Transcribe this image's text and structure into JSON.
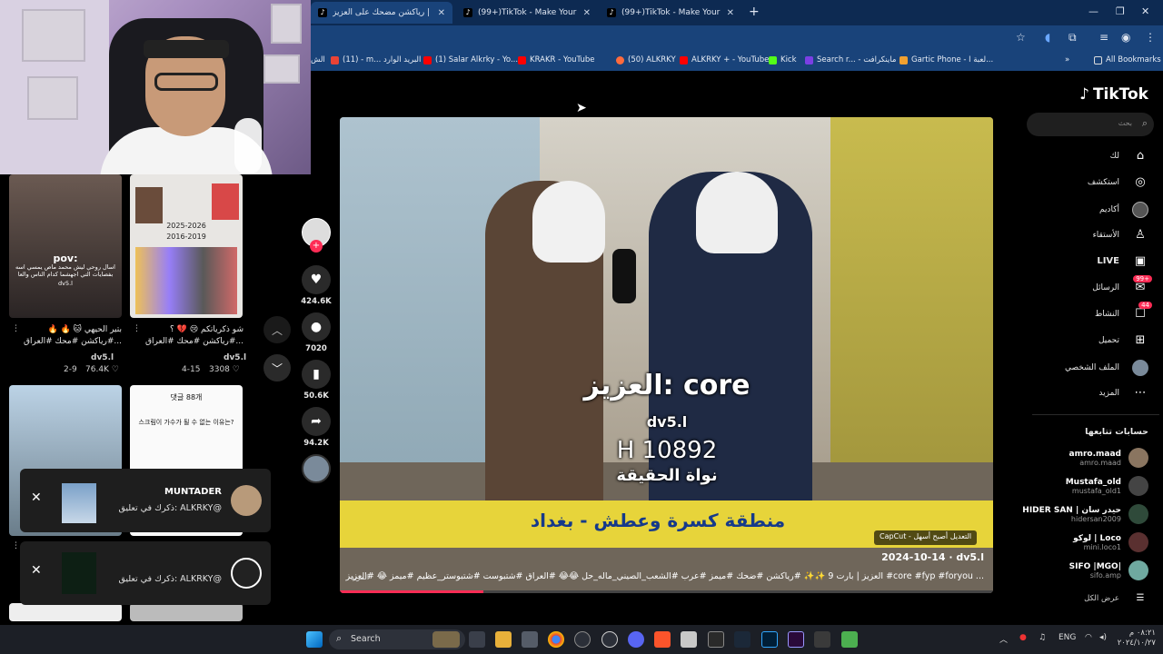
{
  "browser": {
    "tabs": [
      {
        "title": "رياكشن مضحك على العزيز |",
        "active": true
      },
      {
        "title": "(99+)TikTok - Make Your Day",
        "active": false
      },
      {
        "title": "(99+)TikTok - Make Your Day",
        "active": false
      }
    ],
    "new_tab": "+",
    "bookmarks": [
      {
        "label": "الش",
        "color": "#888888"
      },
      {
        "label": "(11) - m... البريد الوارد",
        "color": "#ea4335"
      },
      {
        "label": "(1) Salar Alkrky - Yo...",
        "color": "#ff0000"
      },
      {
        "label": "KRAKR - YouTube",
        "color": "#ff0000"
      },
      {
        "label": "(50) ALKRKY",
        "color": "#ff6b3d"
      },
      {
        "label": "ALKRKY + - YouTube",
        "color": "#ff0000"
      },
      {
        "label": "Kick",
        "color": "#53fc18"
      },
      {
        "label": "Search r... - ماينكرافت",
        "color": "#7b3fe4"
      },
      {
        "label": "Gartic Phone - لعبة ا...",
        "color": "#f0a030"
      }
    ],
    "all_bookmarks": "All Bookmarks"
  },
  "feed": {
    "items": [
      {
        "overlay_title": "pov:",
        "overlay_text": "اسال روحي ليش محمد ماص يمسي اسه بفصايات التي اجهشما كدام الناس والعا",
        "overlay_user": "dv5.l",
        "caption": "بتير الحيهي 🐱 🔥 🔥 #رياكشن #محك #العراق...",
        "user": "dv5.l",
        "date": "2-9",
        "likes": "76.4K"
      },
      {
        "overlay_title": "2025-2026",
        "overlay_text": "2016-2019",
        "caption": "شو ذكرياتكم 😢 💔 ؟ #رياكشن #محك #العراق...",
        "user": "dv5.l",
        "date": "4-15",
        "likes": "3308"
      },
      {
        "overlay_title": "댓글 88개",
        "overlay_text": "스크림이 가수가 될 수 없는 이유는?"
      }
    ]
  },
  "notifications": [
    {
      "title": "MUNTADER",
      "text": "ذكرك في تعليق: ALKRKY@"
    },
    {
      "title": "",
      "text": "ذكرك في تعليق: ALKRKY@"
    }
  ],
  "actions": {
    "likes": "424.6K",
    "comments": "7020",
    "saves": "50.6K",
    "shares": "94.2K"
  },
  "video": {
    "overlay_line1": "العزيز: core",
    "overlay_line2": "dv5.l",
    "overlay_line3": "H 10892",
    "overlay_line4": "نواة الحقيقة",
    "banner": "منطقة كسرة وعطش - بغداد",
    "capcut": "CapCut - التعديل أصبح أسهل",
    "date_user": "2024-10-14 · dv5.l",
    "description": "العزيز | بارت 9 ✨✨ #رياكشن #ضحك #ميمز #عرب #الشعب_الصيني_ماله_حل 😂😂 #العراق #شتبوست #شتبوستر_عظيم #ميمز 😂 #العزيز #core #fyp #foryou ...",
    "more": "المزيد",
    "progress": 0.22
  },
  "sidebar": {
    "logo": "TikTok",
    "search_placeholder": "بحث",
    "nav": [
      {
        "label": "لك",
        "icon": "⌂"
      },
      {
        "label": "استكشف",
        "icon": "◎"
      },
      {
        "label": "أكاديم",
        "icon": "●"
      },
      {
        "label": "الأستقاء",
        "icon": "♙"
      },
      {
        "label": "LIVE",
        "icon": "▣"
      },
      {
        "label": "الرسائل",
        "icon": "✉",
        "badge": "99+"
      },
      {
        "label": "النشاط",
        "icon": "☐",
        "badge": "44"
      },
      {
        "label": "تحميل",
        "icon": "⊞"
      },
      {
        "label": "الملف الشخصي",
        "icon": "●"
      },
      {
        "label": "المزيد",
        "icon": "⋯"
      }
    ],
    "following_title": "حسابات تتابعها",
    "following": [
      {
        "name": "amro.maad",
        "user": "amro.maad",
        "color": "#8a7560"
      },
      {
        "name": "Mustafa_old",
        "user": "mustafa_old1",
        "color": "#444444"
      },
      {
        "name": "HIDER SAN | حيدر سان",
        "user": "hidersan2009",
        "color": "#2f4a3a"
      },
      {
        "name": "لوكو | Loco",
        "user": "mini.loco1",
        "color": "#5a3030"
      },
      {
        "name": "SIFO |MGO|",
        "user": "sifo.amp",
        "color": "#6fa9a0"
      }
    ],
    "show_all": "عرض الكل"
  },
  "taskbar": {
    "search": "Search",
    "language": "ENG",
    "time": "٠٨:٢١ م",
    "date": "٢٠٢٤/١٠/٢٧"
  }
}
